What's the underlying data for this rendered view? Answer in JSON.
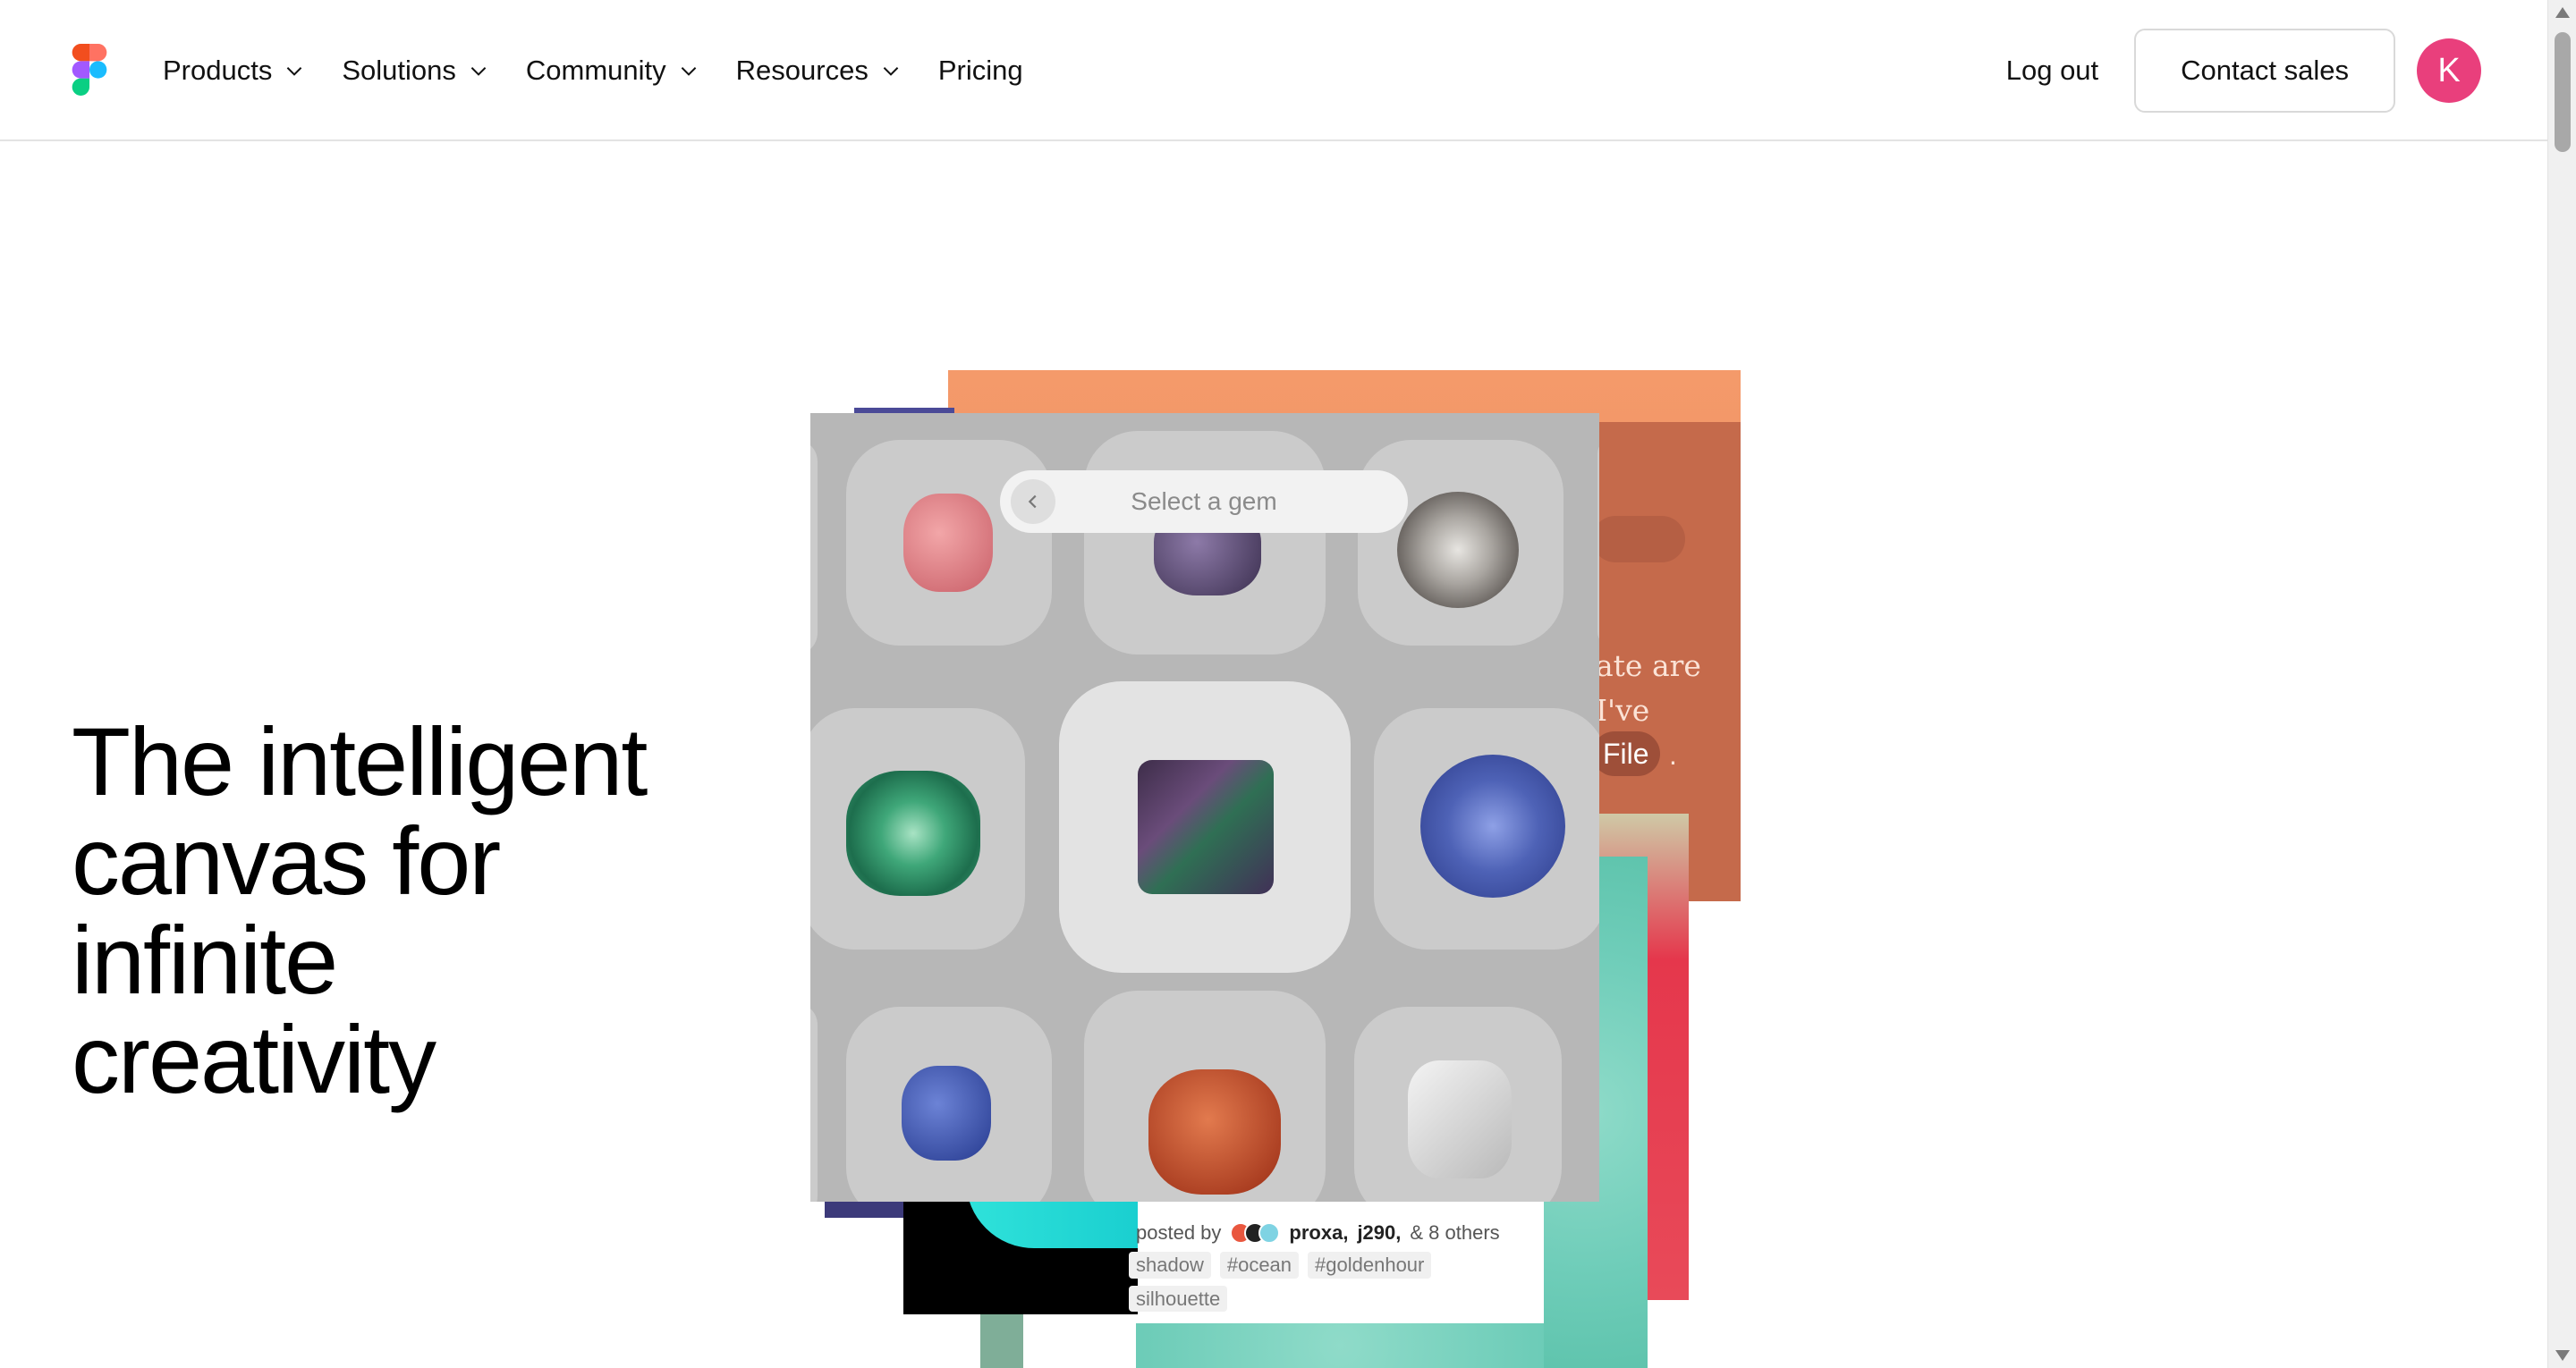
{
  "header": {
    "nav": [
      {
        "label": "Products",
        "has_dropdown": true
      },
      {
        "label": "Solutions",
        "has_dropdown": true
      },
      {
        "label": "Community",
        "has_dropdown": true
      },
      {
        "label": "Resources",
        "has_dropdown": true
      },
      {
        "label": "Pricing",
        "has_dropdown": false
      }
    ],
    "logout_label": "Log out",
    "contact_label": "Contact sales",
    "avatar_initial": "K",
    "avatar_color": "#e93f7c"
  },
  "hero": {
    "title_lines": [
      "The intelligent",
      "canvas for",
      "infinite",
      "creativity"
    ]
  },
  "collage": {
    "gem_picker": {
      "placeholder": "Select a gem",
      "back_icon": "chevron-left-icon"
    },
    "orange_card_text": [
      "ate are",
      "I've"
    ],
    "file_pill": "File",
    "file_pill_suffix": ".",
    "post": {
      "posted_by_label": "posted by",
      "users": [
        "proxa,",
        "j290,"
      ],
      "others": "& 8 others",
      "tags": [
        "shadow",
        "#ocean",
        "#goldenhour",
        "silhouette"
      ]
    }
  },
  "colors": {
    "text": "#111111",
    "accent_orange": "#f49a6a",
    "avatar": "#e93f7c"
  }
}
